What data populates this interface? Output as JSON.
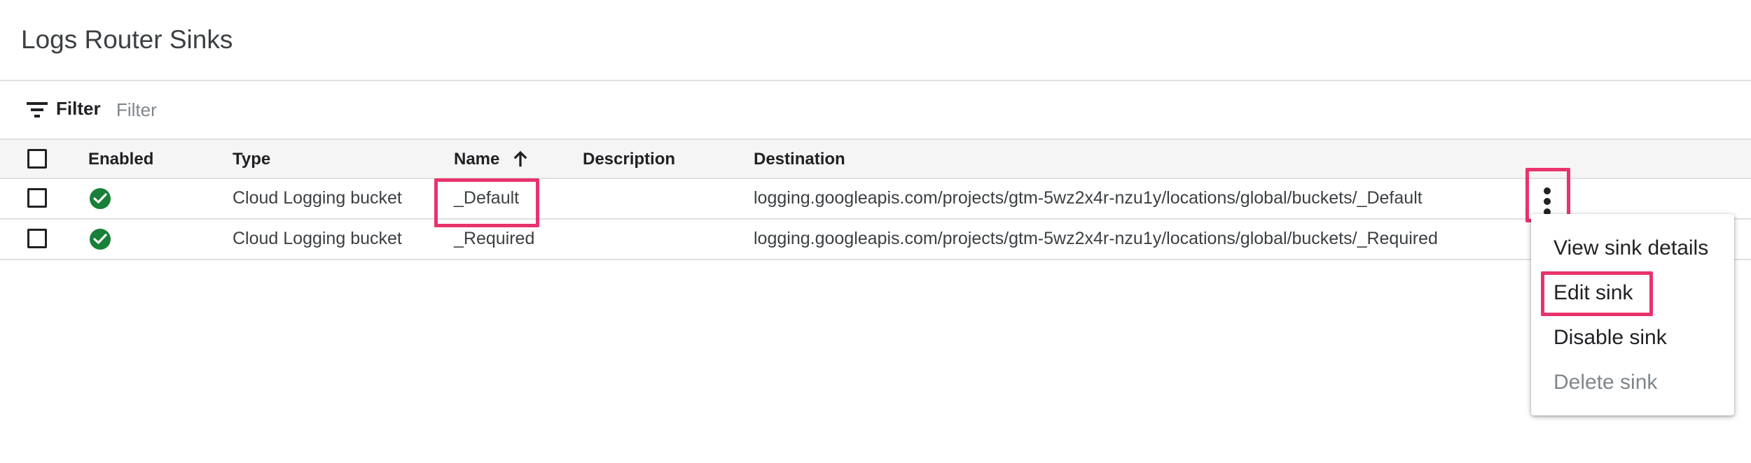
{
  "page": {
    "title": "Logs Router Sinks"
  },
  "filter": {
    "label": "Filter",
    "placeholder": "Filter",
    "value": ""
  },
  "table": {
    "columns": {
      "enabled": "Enabled",
      "type": "Type",
      "name": "Name",
      "description": "Description",
      "destination": "Destination"
    },
    "sort": {
      "column": "Name",
      "direction": "ascending",
      "icon": "arrow-upward-icon"
    },
    "rows": [
      {
        "enabled_icon": "check-circle-icon",
        "type": "Cloud Logging bucket",
        "name": "_Default",
        "description": "",
        "destination": "logging.googleapis.com/projects/gtm-5wz2x4r-nzu1y/locations/global/buckets/_Default"
      },
      {
        "enabled_icon": "check-circle-icon",
        "type": "Cloud Logging bucket",
        "name": "_Required",
        "description": "",
        "destination": "logging.googleapis.com/projects/gtm-5wz2x4r-nzu1y/locations/global/buckets/_Required"
      }
    ]
  },
  "row_menu": {
    "trigger_icon": "more-vert-icon",
    "items": [
      {
        "label": "View sink details",
        "enabled": true
      },
      {
        "label": "Edit sink",
        "enabled": true
      },
      {
        "label": "Disable sink",
        "enabled": true
      },
      {
        "label": "Delete sink",
        "enabled": false
      }
    ]
  },
  "colors": {
    "highlight": "#e8336d",
    "enabled_green": "#188038",
    "header_bg": "#f5f5f5",
    "disabled_text": "#80868b"
  }
}
